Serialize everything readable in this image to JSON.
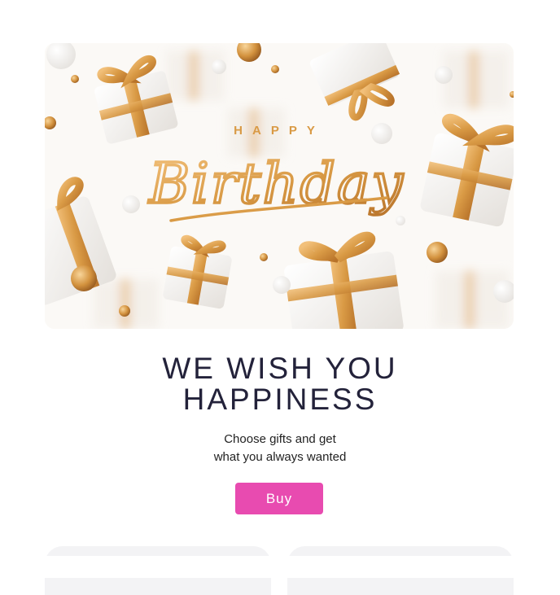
{
  "hero": {
    "happy_text": "HAPPY",
    "birthday_text": "Birthday",
    "colors": {
      "gold": "#d99a45",
      "gold_dark": "#b8732a",
      "box": "#f4f1ee",
      "background": "#fbf9f6"
    }
  },
  "headline": {
    "line1": "WE WISH YOU",
    "line2": "HAPPINESS"
  },
  "subtitle": {
    "line1": "Choose gifts and get",
    "line2": "what you always wanted"
  },
  "buy_button": {
    "label": "Buy",
    "color": "#e84bb0"
  },
  "cards": [
    {},
    {}
  ]
}
